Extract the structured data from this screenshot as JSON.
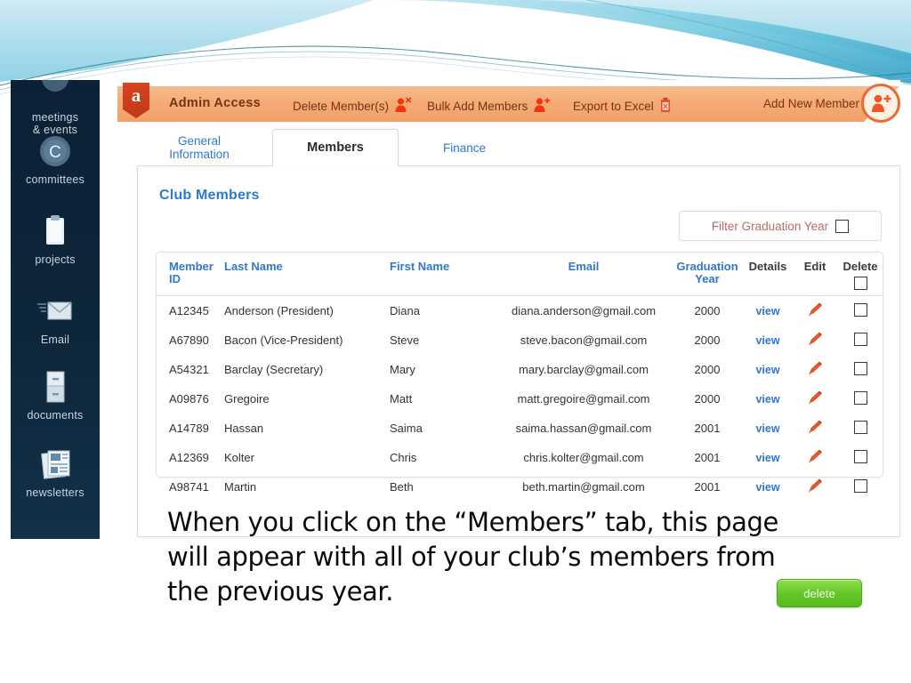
{
  "slide": {
    "caption": "When you click on the “Members” tab, this page will appear with all of your club’s members from the previous year.",
    "deco_colors": {
      "teal": "#4fc3dd",
      "light_blue": "#aadcec",
      "pale": "#d8eff6"
    }
  },
  "sidebar": {
    "items": [
      {
        "label": "meetings\n& events",
        "icon": "calendar-icon"
      },
      {
        "label": "committees",
        "icon": "committees-circle-c-icon"
      },
      {
        "label": "projects",
        "icon": "clipboard-icon"
      },
      {
        "label": "Email",
        "icon": "envelope-icon"
      },
      {
        "label": "documents",
        "icon": "filing-cabinet-icon"
      },
      {
        "label": "newsletters",
        "icon": "newspaper-icon"
      }
    ]
  },
  "admin_bar": {
    "logo_letter": "a",
    "title": "Admin Access",
    "actions": [
      {
        "label": "Delete Member(s)",
        "icon": "person-remove-icon"
      },
      {
        "label": "Bulk Add Members",
        "icon": "person-add-group-icon"
      },
      {
        "label": "Export to Excel",
        "icon": "excel-export-icon"
      }
    ],
    "add_new_label": "Add New Member",
    "add_new_icon": "person-add-circle-icon",
    "accent": "#ea6a30",
    "text_color": "#7b3212"
  },
  "tabs": [
    {
      "id": "general",
      "label_line1": "General",
      "label_line2": "Information",
      "active": false
    },
    {
      "id": "members",
      "label_line1": "Members",
      "label_line2": "",
      "active": true
    },
    {
      "id": "finance",
      "label_line1": "Finance",
      "label_line2": "",
      "active": false
    }
  ],
  "panel": {
    "title": "Club Members",
    "title_color": "#2f78d0",
    "filter": {
      "label": "Filter Graduation Year",
      "checked": false,
      "label_color": "#bb6a6a"
    }
  },
  "table": {
    "headers": {
      "member_id_l1": "Member",
      "member_id_l2": "ID",
      "last_name": "Last Name",
      "first_name": "First Name",
      "email": "Email",
      "grad_l1": "Graduation",
      "grad_l2": "Year",
      "details": "Details",
      "edit": "Edit",
      "delete": "Delete"
    },
    "header_select_all_checked": false,
    "rows": [
      {
        "member_id": "A12345",
        "last_name": "Anderson (President)",
        "first_name": "Diana",
        "email": "diana.anderson@gmail.com",
        "grad_year": "2000",
        "details": "view",
        "edit_icon": "pencil-icon",
        "delete_checked": false
      },
      {
        "member_id": "A67890",
        "last_name": "Bacon (Vice-President)",
        "first_name": "Steve",
        "email": "steve.bacon@gmail.com",
        "grad_year": "2000",
        "details": "view",
        "edit_icon": "pencil-icon",
        "delete_checked": false
      },
      {
        "member_id": "A54321",
        "last_name": "Barclay (Secretary)",
        "first_name": "Mary",
        "email": "mary.barclay@gmail.com",
        "grad_year": "2000",
        "details": "view",
        "edit_icon": "pencil-icon",
        "delete_checked": false
      },
      {
        "member_id": "A09876",
        "last_name": "Gregoire",
        "first_name": "Matt",
        "email": "matt.gregoire@gmail.com",
        "grad_year": "2000",
        "details": "view",
        "edit_icon": "pencil-icon",
        "delete_checked": false
      },
      {
        "member_id": "A14789",
        "last_name": "Hassan",
        "first_name": "Saima",
        "email": "saima.hassan@gmail.com",
        "grad_year": "2001",
        "details": "view",
        "edit_icon": "pencil-icon",
        "delete_checked": false
      },
      {
        "member_id": "A12369",
        "last_name": "Kolter",
        "first_name": "Chris",
        "email": "chris.kolter@gmail.com",
        "grad_year": "2001",
        "details": "view",
        "edit_icon": "pencil-icon",
        "delete_checked": false
      },
      {
        "member_id": "A98741",
        "last_name": "Martin",
        "first_name": "Beth",
        "email": "beth.martin@gmail.com",
        "grad_year": "2001",
        "details": "view",
        "edit_icon": "pencil-icon",
        "delete_checked": false
      }
    ]
  },
  "delete_button": {
    "label": "delete",
    "color": "#63c728"
  }
}
